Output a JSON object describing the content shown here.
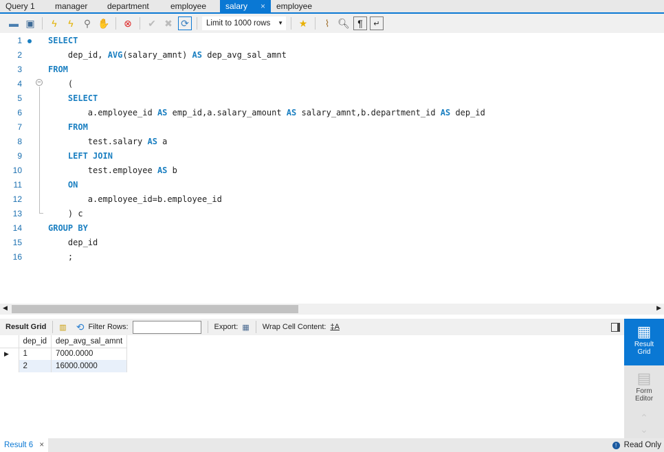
{
  "tabs": [
    {
      "label": "Query 1"
    },
    {
      "label": "manager"
    },
    {
      "label": "department"
    },
    {
      "label": "employee"
    },
    {
      "label": "salary",
      "active": true,
      "close": "×"
    },
    {
      "label": "employee"
    }
  ],
  "toolbar": {
    "limit": "Limit to 1000 rows",
    "icons": [
      "open-folder",
      "save",
      "execute",
      "execute-current",
      "explain",
      "stop",
      "toggle-error",
      "commit",
      "rollback",
      "autocommit",
      "limit",
      "bookmark",
      "beautify",
      "find",
      "invisible-chars",
      "wrap"
    ]
  },
  "editor": {
    "lines": [
      [
        {
          "t": "SELECT",
          "k": 1
        }
      ],
      [
        {
          "t": "    dep_id, "
        },
        {
          "t": "AVG",
          "k": 1
        },
        {
          "t": "(salary_amnt) "
        },
        {
          "t": "AS",
          "k": 1
        },
        {
          "t": " dep_avg_sal_amnt"
        }
      ],
      [
        {
          "t": "FROM",
          "k": 1
        }
      ],
      [
        {
          "t": "    ("
        }
      ],
      [
        {
          "t": "    "
        },
        {
          "t": "SELECT",
          "k": 1
        }
      ],
      [
        {
          "t": "        a.employee_id "
        },
        {
          "t": "AS",
          "k": 1
        },
        {
          "t": " emp_id,a.salary_amount "
        },
        {
          "t": "AS",
          "k": 1
        },
        {
          "t": " salary_amnt,b.department_id "
        },
        {
          "t": "AS",
          "k": 1
        },
        {
          "t": " dep_id"
        }
      ],
      [
        {
          "t": "    "
        },
        {
          "t": "FROM",
          "k": 1
        }
      ],
      [
        {
          "t": "        test.salary "
        },
        {
          "t": "AS",
          "k": 1
        },
        {
          "t": " a"
        }
      ],
      [
        {
          "t": "    "
        },
        {
          "t": "LEFT JOIN",
          "k": 1
        }
      ],
      [
        {
          "t": "        test.employee "
        },
        {
          "t": "AS",
          "k": 1
        },
        {
          "t": " b"
        }
      ],
      [
        {
          "t": "    "
        },
        {
          "t": "ON",
          "k": 1
        }
      ],
      [
        {
          "t": "        a.employee_id=b.employee_id"
        }
      ],
      [
        {
          "t": "    ) c"
        }
      ],
      [
        {
          "t": "GROUP BY",
          "k": 1
        }
      ],
      [
        {
          "t": "    dep_id"
        }
      ],
      [
        {
          "t": "    ;"
        }
      ]
    ]
  },
  "results": {
    "result_grid": "Result Grid",
    "filter_label": "Filter Rows:",
    "filter_value": "",
    "export_label": "Export:",
    "wrap_label": "Wrap Cell Content:",
    "columns": [
      "dep_id",
      "dep_avg_sal_amnt"
    ],
    "rows": [
      [
        "1",
        "7000.0000"
      ],
      [
        "2",
        "16000.0000"
      ]
    ]
  },
  "side": {
    "result_grid": "Result Grid",
    "form_editor": "Form Editor"
  },
  "status": {
    "tab": "Result 6",
    "close": "×",
    "mode": "Read Only"
  },
  "colors": {
    "accent": "#0a78d4",
    "keyword": "#1a7fc1"
  }
}
